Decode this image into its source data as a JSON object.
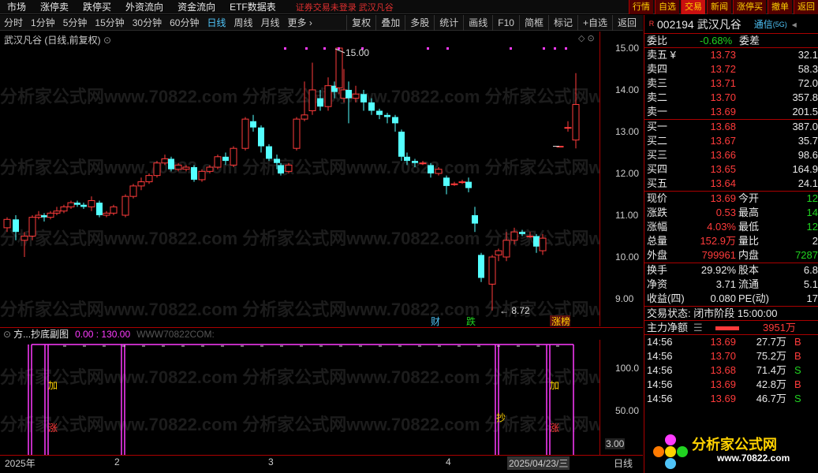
{
  "menu": [
    "市场",
    "涨停卖",
    "跌停买",
    "外资流向",
    "资金流向",
    "ETF数据表"
  ],
  "notice": "证券交易未登录  武汉凡谷",
  "trade_buttons": [
    "行情",
    "自选",
    "交易",
    "新闻",
    "涨停买",
    "撤单",
    "返回"
  ],
  "periods": [
    "分时",
    "1分钟",
    "5分钟",
    "15分钟",
    "30分钟",
    "60分钟",
    "日线",
    "周线",
    "月线",
    "更多 ›"
  ],
  "active_period": "日线",
  "tools": [
    "复权",
    "叠加",
    "多股",
    "统计",
    "画线",
    "F10",
    "简框",
    "标记",
    "+自选",
    "返回"
  ],
  "chart_title": "武汉凡谷 (日线,前复权)",
  "price_ticks": [
    "15.00",
    "14.00",
    "13.00",
    "12.00",
    "11.00",
    "10.00",
    "9.00"
  ],
  "max_label": "15.00",
  "min_label": "8.72",
  "markers": {
    "cai": "财",
    "die": "跌",
    "zhang": "涨榜"
  },
  "sub_title": {
    "name": "方...抄底副图",
    "values": "0.00 : 130.00",
    "wm": "WWW70822COM:"
  },
  "sub_ticks": [
    "100.0",
    "50.00"
  ],
  "sub_marks": {
    "jia1": "加",
    "zhang1": "涨",
    "chao": "抄",
    "jia2": "加",
    "zhang2": "涨"
  },
  "bottom": {
    "d1": "2025年",
    "d2": "2",
    "d3": "3",
    "d4": "4",
    "cur": "2025/04/23/三",
    "cur_val": "3.00",
    "period": "日线"
  },
  "stock": {
    "code": "002194",
    "name": "武汉凡谷",
    "tag": "通信",
    "tag2": "(5G)",
    "r_icon": "R"
  },
  "weibi": {
    "label": "委比",
    "value": "-0.68%",
    "label2": "委差"
  },
  "asks": [
    {
      "l": "卖五 ¥",
      "p": "13.73",
      "v": "32.1"
    },
    {
      "l": "卖四",
      "p": "13.72",
      "v": "58.3"
    },
    {
      "l": "卖三",
      "p": "13.71",
      "v": "72.0"
    },
    {
      "l": "卖二",
      "p": "13.70",
      "v": "357.8"
    },
    {
      "l": "卖一",
      "p": "13.69",
      "v": "201.5"
    }
  ],
  "bids": [
    {
      "l": "买一",
      "p": "13.68",
      "v": "387.0"
    },
    {
      "l": "买二",
      "p": "13.67",
      "v": "35.7"
    },
    {
      "l": "买三",
      "p": "13.66",
      "v": "98.6"
    },
    {
      "l": "买四",
      "p": "13.65",
      "v": "164.9"
    },
    {
      "l": "买五",
      "p": "13.64",
      "v": "24.1"
    }
  ],
  "quote": [
    {
      "l1": "现价",
      "v1": "13.69",
      "l2": "今开",
      "v2": "12"
    },
    {
      "l1": "涨跌",
      "v1": "0.53",
      "l2": "最高",
      "v2": "14"
    },
    {
      "l1": "涨幅",
      "v1": "4.03%",
      "l2": "最低",
      "v2": "12"
    },
    {
      "l1": "总量",
      "v1": "152.9万",
      "l2": "量比",
      "v2": "2"
    },
    {
      "l1": "外盘",
      "v1": "799961",
      "l2": "内盘",
      "v2": "7287"
    }
  ],
  "quote2": [
    {
      "l1": "换手",
      "v1": "29.92%",
      "l2": "股本",
      "v2": "6.8"
    },
    {
      "l1": "净资",
      "v1": "3.71",
      "l2": "流通",
      "v2": "5.1"
    },
    {
      "l1": "收益(四)",
      "v1": "0.080",
      "l2": "PE(动)",
      "v2": "17"
    }
  ],
  "trade_state": "交易状态: 闭市阶段 15:00:00",
  "mainflow": {
    "label": "主力净额",
    "value": "3951万"
  },
  "ticks": [
    {
      "t": "14:56",
      "p": "13.69",
      "v": "27.7万",
      "s": "B"
    },
    {
      "t": "14:56",
      "p": "13.70",
      "v": "75.2万",
      "s": "B"
    },
    {
      "t": "14:56",
      "p": "13.68",
      "v": "71.4万",
      "s": "S"
    },
    {
      "t": "14:56",
      "p": "13.69",
      "v": "42.8万",
      "s": "B"
    },
    {
      "t": "14:56",
      "p": "13.69",
      "v": "46.7万",
      "s": "S"
    }
  ],
  "logo": {
    "text": "分析家公式网",
    "url": "www.70822.com"
  },
  "watermark": "分析家公式网www.70822.com"
}
